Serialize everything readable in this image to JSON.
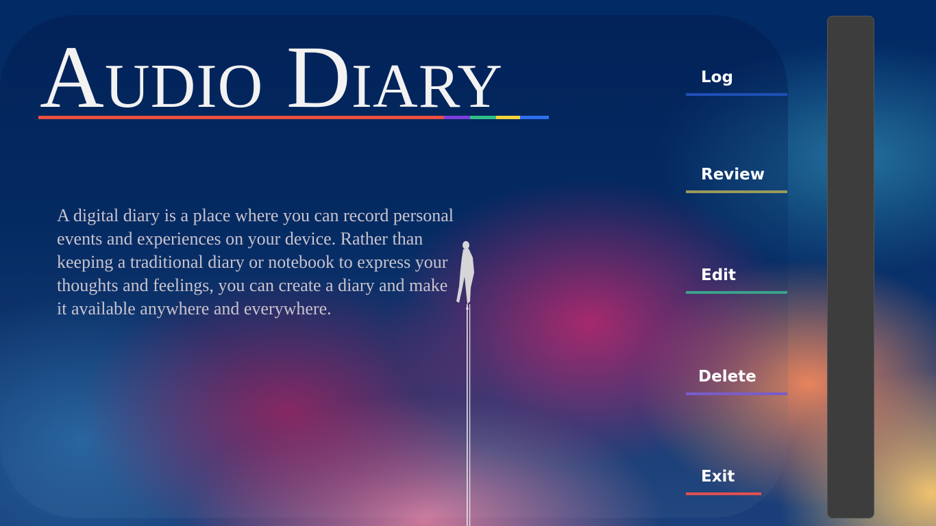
{
  "app": {
    "title": "Audio Diary",
    "title_underline_colors": [
      "#e8503f",
      "#7d3ee0",
      "#2fbf86",
      "#f2d33c",
      "#2e6ef0"
    ]
  },
  "intro": {
    "text": "A digital diary is a place where you can record personal events and experiences on your device. Rather than keeping a traditional diary or notebook to express your thoughts and feelings, you can create a diary and make it available anywhere and everywhere."
  },
  "menu": {
    "items": [
      {
        "label": "Log",
        "accent": "#1f4fb8"
      },
      {
        "label": "Review",
        "accent": "#9a9a5a"
      },
      {
        "label": "Edit",
        "accent": "#3aa28c"
      },
      {
        "label": "Delete",
        "accent": "#7a5cc8"
      },
      {
        "label": "Exit",
        "accent": "#e05050"
      }
    ]
  },
  "icons": {
    "figure": "floating-person-icon"
  }
}
